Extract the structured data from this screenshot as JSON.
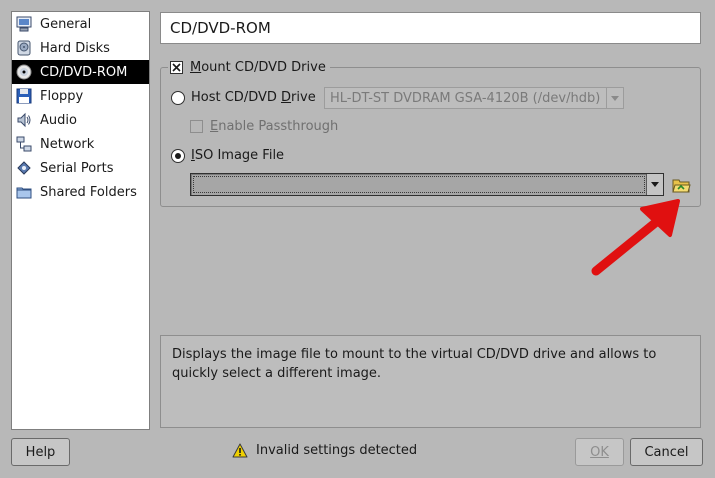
{
  "sidebar": {
    "items": [
      {
        "label": "General",
        "icon": "computer-icon"
      },
      {
        "label": "Hard Disks",
        "icon": "hard-disk-icon"
      },
      {
        "label": "CD/DVD-ROM",
        "icon": "cd-icon",
        "selected": true
      },
      {
        "label": "Floppy",
        "icon": "floppy-icon"
      },
      {
        "label": "Audio",
        "icon": "audio-icon"
      },
      {
        "label": "Network",
        "icon": "network-icon"
      },
      {
        "label": "Serial Ports",
        "icon": "serial-port-icon"
      },
      {
        "label": "Shared Folders",
        "icon": "shared-folder-icon"
      }
    ]
  },
  "page_title": "CD/DVD-ROM",
  "mount": {
    "checked": true,
    "label_pre": "",
    "label_accel": "M",
    "label_post": "ount CD/DVD Drive"
  },
  "host_drive": {
    "label_pre": "Host CD/DVD ",
    "label_accel": "D",
    "label_post": "rive",
    "selected": false,
    "combo_value": "HL-DT-ST DVDRAM GSA-4120B (/dev/hdb)"
  },
  "passthrough": {
    "label_pre": "",
    "label_accel": "E",
    "label_post": "nable Passthrough",
    "checked": false
  },
  "iso": {
    "label_pre": "",
    "label_accel": "I",
    "label_post": "SO Image File",
    "selected": true,
    "combo_value": ""
  },
  "info_text": "Displays the image file to mount to the virtual CD/DVD drive and allows to quickly select a different image.",
  "status": {
    "text": "Invalid settings detected",
    "icon": "warning-icon"
  },
  "buttons": {
    "help": "Help",
    "ok": "OK",
    "cancel": "Cancel"
  },
  "colors": {
    "window_bg": "#b8b8b8",
    "selection": "#000000",
    "annotation_arrow": "#e01010",
    "warning": "#f0d000"
  }
}
